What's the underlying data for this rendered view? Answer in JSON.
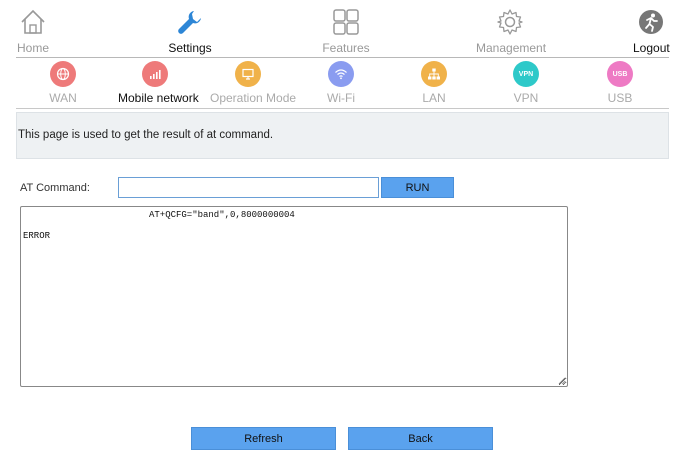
{
  "top_nav": {
    "items": [
      {
        "label": "Home",
        "icon": "home-icon",
        "state": "inactive"
      },
      {
        "label": "Settings",
        "icon": "wrench-icon",
        "state": "active"
      },
      {
        "label": "Features",
        "icon": "grid-icon",
        "state": "inactive"
      },
      {
        "label": "Management",
        "icon": "gear-icon",
        "state": "inactive"
      },
      {
        "label": "Logout",
        "icon": "runner-icon",
        "state": "inactive"
      }
    ]
  },
  "sub_nav": {
    "items": [
      {
        "label": "WAN",
        "icon": "globe-icon",
        "color": "#ee7a7a"
      },
      {
        "label": "Mobile network",
        "icon": "signal-bars-icon",
        "color": "#ee7a7a",
        "active": true
      },
      {
        "label": "Operation Mode",
        "icon": "monitor-icon",
        "color": "#f0b24a"
      },
      {
        "label": "Wi-Fi",
        "icon": "wifi-icon",
        "color": "#8a9cf0"
      },
      {
        "label": "LAN",
        "icon": "network-icon",
        "color": "#f0b24a"
      },
      {
        "label": "VPN",
        "icon": "vpn-icon",
        "color": "#2ec9c9",
        "badge": "VPN"
      },
      {
        "label": "USB",
        "icon": "usb-icon",
        "color": "#ee7ac4",
        "badge": "USB"
      }
    ]
  },
  "description": "This page is used to get the result of at command.",
  "at_command": {
    "label": "AT Command:",
    "value": "",
    "run_label": "RUN"
  },
  "result": {
    "line1": "AT+QCFG=\"band\",0,8000000004",
    "line2": "ERROR"
  },
  "buttons": {
    "refresh": "Refresh",
    "back": "Back"
  },
  "colors": {
    "accent": "#5aa2ee",
    "active_nav": "#2d86d6"
  }
}
